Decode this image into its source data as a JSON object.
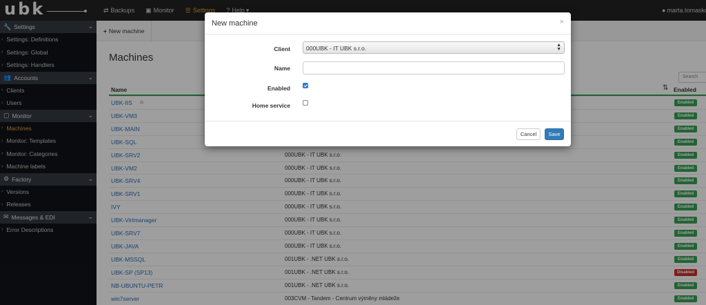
{
  "brand": "ubk",
  "nav": [
    {
      "label": "Backups",
      "icon": "⇄"
    },
    {
      "label": "Monitor",
      "icon": "▣"
    },
    {
      "label": "Settings",
      "icon": "☰"
    },
    {
      "label": "Help",
      "icon": "?"
    }
  ],
  "nav_help_caret": "▾",
  "user": {
    "name": "marta.tomasko",
    "icon": "user-icon"
  },
  "sidebar": {
    "sections": [
      {
        "label": "Settings",
        "icon": "wrench-icon",
        "items": [
          "Settings: Definitions",
          "Settings: Global",
          "Settings: Handlers"
        ]
      },
      {
        "label": "Accounts",
        "icon": "users-icon",
        "items": [
          "Clients",
          "Users"
        ]
      },
      {
        "label": "Monitor",
        "icon": "desktop-icon",
        "items": [
          "Machines",
          "Monitor: Templates",
          "Monitor: Categories",
          "Machine labels"
        ]
      },
      {
        "label": "Factory",
        "icon": "gears-icon",
        "items": [
          "Versions",
          "Releases"
        ]
      },
      {
        "label": "Messages & EDI",
        "icon": "envelope-icon",
        "items": [
          "Error Descriptions"
        ]
      }
    ],
    "active_item": "Machines"
  },
  "actionbar": {
    "new_label": "New machine"
  },
  "page": {
    "title": "Machines",
    "search_placeholder": "Search"
  },
  "table": {
    "headers": {
      "name": "Name",
      "enabled": "Enabled"
    },
    "rows": [
      {
        "name": "UBK-IIS",
        "home": true,
        "client": "",
        "status": "Enabled"
      },
      {
        "name": "UBK-VM3",
        "client": "",
        "status": "Enabled"
      },
      {
        "name": "UBK-MAIN",
        "client": "",
        "status": "Enabled"
      },
      {
        "name": "UBK-SQL",
        "client": "",
        "status": "Enabled"
      },
      {
        "name": "UBK-SRV2",
        "client": "000UBK - IT UBK s.r.o.",
        "status": "Enabled"
      },
      {
        "name": "UBK-VM2",
        "client": "000UBK - IT UBK s.r.o.",
        "status": "Enabled"
      },
      {
        "name": "UBK-SRV4",
        "client": "000UBK - IT UBK s.r.o.",
        "status": "Enabled"
      },
      {
        "name": "UBK-SRV1",
        "client": "000UBK - IT UBK s.r.o.",
        "status": "Enabled"
      },
      {
        "name": "IVY",
        "client": "000UBK - IT UBK s.r.o.",
        "status": "Enabled"
      },
      {
        "name": "UBK-Virtmanager",
        "client": "000UBK - IT UBK s.r.o.",
        "status": "Enabled"
      },
      {
        "name": "UBK-SRV7",
        "client": "000UBK - IT UBK s.r.o.",
        "status": "Enabled"
      },
      {
        "name": "UBK-JAVA",
        "client": "000UBK - IT UBK s.r.o.",
        "status": "Enabled"
      },
      {
        "name": "UBK-MSSQL",
        "client": "001UBK - .NET UBK s.r.o.",
        "status": "Enabled"
      },
      {
        "name": "UBK-SP (SP13)",
        "client": "001UBK - .NET UBK s.r.o.",
        "status": "Disabled"
      },
      {
        "name": "NB-UBUNTU-PETR",
        "client": "001UBK - .NET UBK s.r.o.",
        "status": "Enabled"
      },
      {
        "name": "win7server",
        "client": "003CVM - Tandem - Centrum výměny mládeže",
        "status": "Enabled"
      }
    ]
  },
  "modal": {
    "title": "New machine",
    "close": "×",
    "fields": {
      "client_label": "Client",
      "client_value": "000UBK - IT UBK s.r.o.",
      "name_label": "Name",
      "name_value": "",
      "enabled_label": "Enabled",
      "enabled_checked": true,
      "home_label": "Home service",
      "home_checked": false
    },
    "cancel_label": "Cancel",
    "save_label": "Save"
  },
  "colors": {
    "accent": "#e8a13b",
    "link": "#2a6db0",
    "enabled": "#37a155",
    "disabled": "#c9302c",
    "primary": "#337ab7"
  }
}
